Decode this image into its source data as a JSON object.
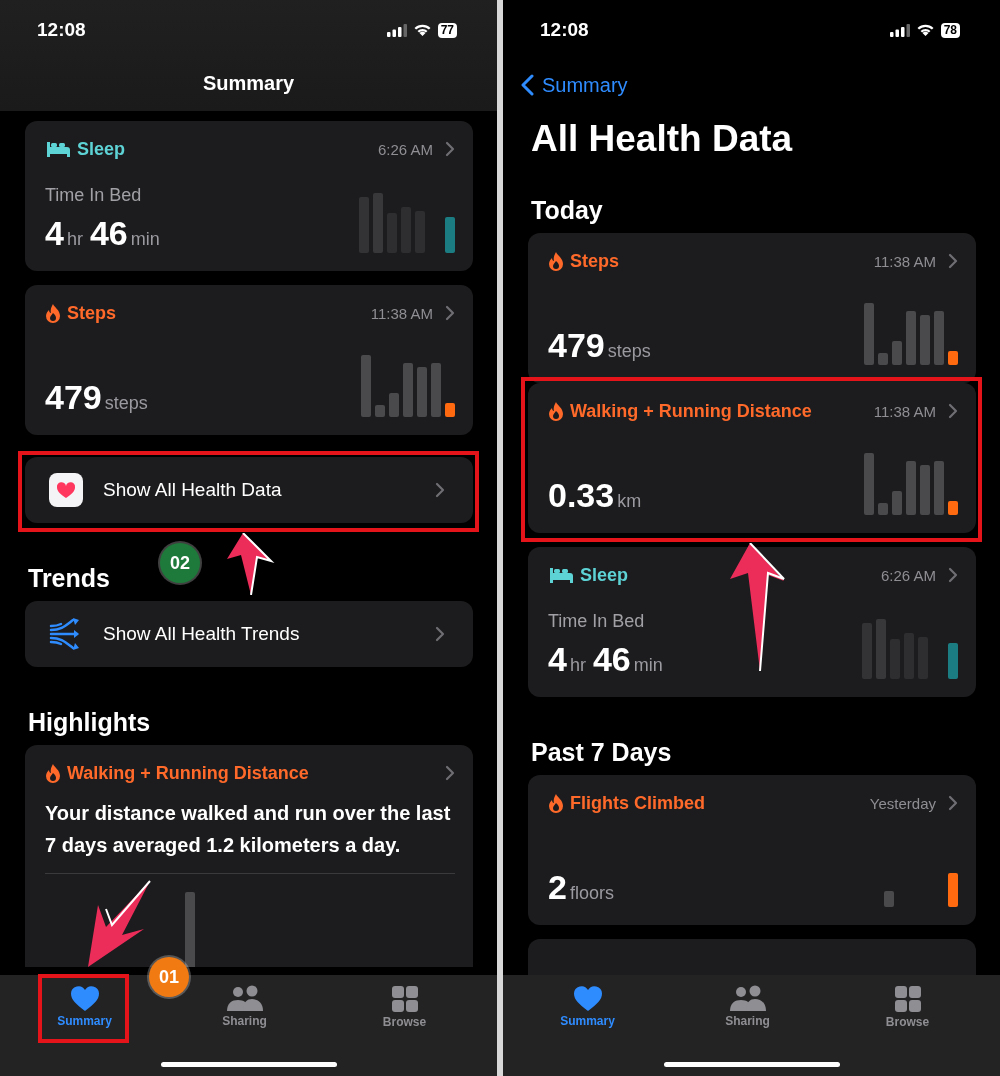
{
  "phones": [
    {
      "status_bar": {
        "time": "12:08",
        "battery": "77"
      },
      "header": {
        "kind": "inline",
        "title": "Summary"
      },
      "content": [
        {
          "kind": "sleep",
          "color": "#5ed3d6",
          "title": "Sleep",
          "time": "6:26 AM",
          "label": "Time In Bed",
          "value": [
            {
              "number": "4",
              "unit": "hr"
            },
            {
              "number": "46",
              "unit": "min"
            }
          ]
        },
        {
          "kind": "activity",
          "color": "#ff6a2a",
          "title": "Steps",
          "time": "11:38 AM",
          "value": [
            {
              "number": "479",
              "unit": "steps"
            }
          ]
        },
        {
          "kind": "applink",
          "label": "Show All Health Data",
          "annotated": true,
          "badge": {
            "text": "02",
            "color": "#1d7a3a"
          }
        },
        {
          "kind": "heading",
          "text": "Trends"
        },
        {
          "kind": "trendslink",
          "label": "Show All Health Trends"
        },
        {
          "kind": "heading",
          "text": "Highlights"
        },
        {
          "kind": "highlight",
          "color": "#ff6a2a",
          "title": "Walking + Running Distance",
          "text": "Your distance walked and run over the last 7 days averaged 1.2 kilometers a day."
        }
      ],
      "tabs": [
        {
          "label": "Summary",
          "selected": true,
          "annotated": true,
          "badge": {
            "text": "01",
            "color": "#f27a12"
          }
        },
        {
          "label": "Sharing",
          "selected": false
        },
        {
          "label": "Browse",
          "selected": false
        }
      ]
    },
    {
      "status_bar": {
        "time": "12:08",
        "battery": "78"
      },
      "header": {
        "kind": "large",
        "back": "Summary",
        "title": "All Health Data"
      },
      "content": [
        {
          "kind": "heading",
          "text": "Today"
        },
        {
          "kind": "activity",
          "color": "#ff6a2a",
          "title": "Steps",
          "time": "11:38 AM",
          "value": [
            {
              "number": "479",
              "unit": "steps"
            }
          ]
        },
        {
          "kind": "activity",
          "color": "#ff6a2a",
          "title": "Walking + Running Distance",
          "time": "11:38 AM",
          "value": [
            {
              "number": "0.33",
              "unit": "km"
            }
          ],
          "annotated": true
        },
        {
          "kind": "sleep",
          "color": "#5ed3d6",
          "title": "Sleep",
          "time": "6:26 AM",
          "label": "Time In Bed",
          "value": [
            {
              "number": "4",
              "unit": "hr"
            },
            {
              "number": "46",
              "unit": "min"
            }
          ]
        },
        {
          "kind": "heading",
          "text": "Past 7 Days"
        },
        {
          "kind": "climb",
          "color": "#ff6a2a",
          "title": "Flights Climbed",
          "time": "Yesterday",
          "value": [
            {
              "number": "2",
              "unit": "floors"
            }
          ]
        },
        {
          "kind": "peek"
        }
      ],
      "tabs": [
        {
          "label": "Summary",
          "selected": true
        },
        {
          "label": "Sharing",
          "selected": false
        },
        {
          "label": "Browse",
          "selected": false
        }
      ]
    }
  ]
}
